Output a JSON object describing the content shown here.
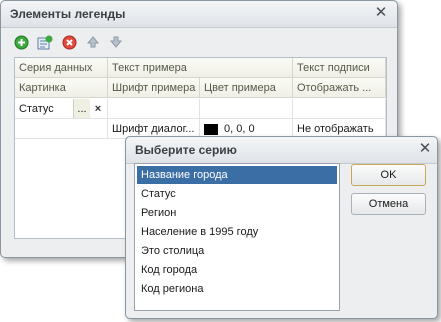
{
  "legend_window": {
    "title": "Элементы легенды",
    "toolbar": {
      "add_icon": "add-circle-icon",
      "edit_icon": "edit-list-icon",
      "delete_icon": "delete-circle-icon",
      "up_icon": "arrow-up-icon",
      "down_icon": "arrow-down-icon"
    },
    "columns_row1": [
      "Серия данных",
      "Текст примера",
      "Текст подписи"
    ],
    "columns_row2": [
      "Картинка",
      "Шрифт примера",
      "Цвет примера",
      "Отображать ..."
    ],
    "rows": [
      {
        "series": "Статус",
        "button": "...",
        "clear": "×"
      },
      {
        "font": "Шрифт диалог...",
        "color_text": "0, 0, 0",
        "color_swatch": "#000000",
        "display": "Не отображать"
      }
    ]
  },
  "series_dialog": {
    "title": "Выберите серию",
    "items": [
      "Название города",
      "Статус",
      "Регион",
      "Население в 1995 году",
      "Это столица",
      "Код города",
      "Код региона"
    ],
    "selected_index": 0,
    "ok_label": "OK",
    "cancel_label": "Отмена"
  },
  "colors": {
    "selection": "#3a6ea5",
    "dialog_ok_border": "#c9a85a"
  }
}
